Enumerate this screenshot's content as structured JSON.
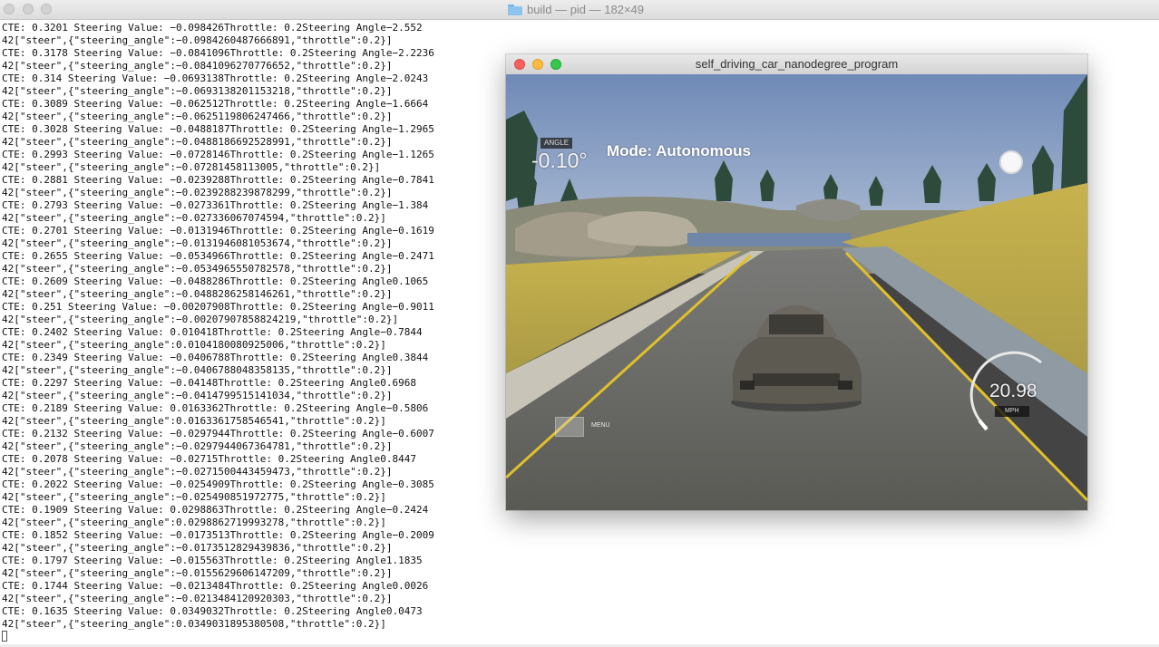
{
  "terminal": {
    "title": "build — pid — 182×49",
    "lines": [
      "CTE: 0.3201 Steering Value: −0.098426Throttle: 0.2Steering Angle−2.552",
      "42[\"steer\",{\"steering_angle\":−0.0984260487666891,\"throttle\":0.2}]",
      "CTE: 0.3178 Steering Value: −0.0841096Throttle: 0.2Steering Angle−2.2236",
      "42[\"steer\",{\"steering_angle\":−0.0841096270776652,\"throttle\":0.2}]",
      "CTE: 0.314 Steering Value: −0.0693138Throttle: 0.2Steering Angle−2.0243",
      "42[\"steer\",{\"steering_angle\":−0.0693138201153218,\"throttle\":0.2}]",
      "CTE: 0.3089 Steering Value: −0.062512Throttle: 0.2Steering Angle−1.6664",
      "42[\"steer\",{\"steering_angle\":−0.0625119806247466,\"throttle\":0.2}]",
      "CTE: 0.3028 Steering Value: −0.0488187Throttle: 0.2Steering Angle−1.2965",
      "42[\"steer\",{\"steering_angle\":−0.0488186692528991,\"throttle\":0.2}]",
      "CTE: 0.2993 Steering Value: −0.0728146Throttle: 0.2Steering Angle−1.1265",
      "42[\"steer\",{\"steering_angle\":−0.07281458113005,\"throttle\":0.2}]",
      "CTE: 0.2881 Steering Value: −0.0239288Throttle: 0.2Steering Angle−0.7841",
      "42[\"steer\",{\"steering_angle\":−0.0239288239878299,\"throttle\":0.2}]",
      "CTE: 0.2793 Steering Value: −0.0273361Throttle: 0.2Steering Angle−1.384",
      "42[\"steer\",{\"steering_angle\":−0.027336067074594,\"throttle\":0.2}]",
      "CTE: 0.2701 Steering Value: −0.0131946Throttle: 0.2Steering Angle−0.1619",
      "42[\"steer\",{\"steering_angle\":−0.0131946081053674,\"throttle\":0.2}]",
      "CTE: 0.2655 Steering Value: −0.0534966Throttle: 0.2Steering Angle−0.2471",
      "42[\"steer\",{\"steering_angle\":−0.0534965550782578,\"throttle\":0.2}]",
      "CTE: 0.2609 Steering Value: −0.0488286Throttle: 0.2Steering Angle0.1065",
      "42[\"steer\",{\"steering_angle\":−0.0488286258146261,\"throttle\":0.2}]",
      "CTE: 0.251 Steering Value: −0.00207908Throttle: 0.2Steering Angle−0.9011",
      "42[\"steer\",{\"steering_angle\":−0.00207907858824219,\"throttle\":0.2}]",
      "CTE: 0.2402 Steering Value: 0.010418Throttle: 0.2Steering Angle−0.7844",
      "42[\"steer\",{\"steering_angle\":0.0104180080925006,\"throttle\":0.2}]",
      "CTE: 0.2349 Steering Value: −0.0406788Throttle: 0.2Steering Angle0.3844",
      "42[\"steer\",{\"steering_angle\":−0.0406788048358135,\"throttle\":0.2}]",
      "CTE: 0.2297 Steering Value: −0.04148Throttle: 0.2Steering Angle0.6968",
      "42[\"steer\",{\"steering_angle\":−0.0414799515141034,\"throttle\":0.2}]",
      "CTE: 0.2189 Steering Value: 0.0163362Throttle: 0.2Steering Angle−0.5806",
      "42[\"steer\",{\"steering_angle\":0.0163361758546541,\"throttle\":0.2}]",
      "CTE: 0.2132 Steering Value: −0.0297944Throttle: 0.2Steering Angle−0.6007",
      "42[\"steer\",{\"steering_angle\":−0.0297944067364781,\"throttle\":0.2}]",
      "CTE: 0.2078 Steering Value: −0.02715Throttle: 0.2Steering Angle0.8447",
      "42[\"steer\",{\"steering_angle\":−0.0271500443459473,\"throttle\":0.2}]",
      "CTE: 0.2022 Steering Value: −0.0254909Throttle: 0.2Steering Angle−0.3085",
      "42[\"steer\",{\"steering_angle\":−0.025490851972775,\"throttle\":0.2}]",
      "CTE: 0.1909 Steering Value: 0.0298863Throttle: 0.2Steering Angle−0.2424",
      "42[\"steer\",{\"steering_angle\":0.0298862719993278,\"throttle\":0.2}]",
      "CTE: 0.1852 Steering Value: −0.0173513Throttle: 0.2Steering Angle−0.2009",
      "42[\"steer\",{\"steering_angle\":−0.0173512829439836,\"throttle\":0.2}]",
      "CTE: 0.1797 Steering Value: −0.015563Throttle: 0.2Steering Angle1.1835",
      "42[\"steer\",{\"steering_angle\":−0.0155629606147209,\"throttle\":0.2}]",
      "CTE: 0.1744 Steering Value: −0.0213484Throttle: 0.2Steering Angle0.0026",
      "42[\"steer\",{\"steering_angle\":−0.0213484120920303,\"throttle\":0.2}]",
      "CTE: 0.1635 Steering Value: 0.0349032Throttle: 0.2Steering Angle0.0473",
      "42[\"steer\",{\"steering_angle\":0.0349031895380508,\"throttle\":0.2}]"
    ]
  },
  "simulator": {
    "title": "self_driving_car_nanodegree_program",
    "hud": {
      "angle_label": "ANGLE",
      "angle_value": "-0.10°",
      "mode": "Mode: Autonomous",
      "menu_label": "MENU",
      "speed_value": "20.98",
      "speed_unit": "MPH"
    }
  },
  "colors": {
    "close": "#fc605c",
    "minimize": "#fdbc40",
    "zoom": "#34c84a",
    "sky": "#8aa3c9",
    "grass": "#c9b24e",
    "road": "#6b6b66",
    "lane": "#e2c02a"
  }
}
